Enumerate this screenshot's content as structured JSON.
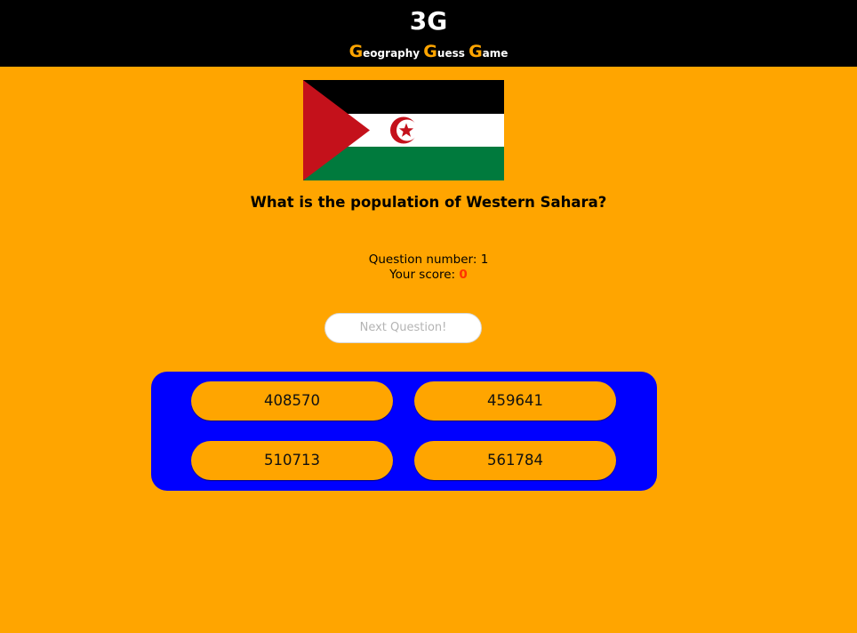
{
  "header": {
    "logo": "3G",
    "tagline": [
      {
        "cap": "G",
        "rest": "eography "
      },
      {
        "cap": "G",
        "rest": "uess "
      },
      {
        "cap": "G",
        "rest": "ame"
      }
    ]
  },
  "flag": {
    "country": "Western Sahara",
    "icon": "western-sahara-flag-icon",
    "colors": {
      "black": "#000000",
      "white": "#FFFFFF",
      "green": "#007A3D",
      "red": "#C4111B"
    }
  },
  "question": {
    "text": "What is the population of Western Sahara?"
  },
  "status": {
    "question_label": "Question number: ",
    "question_number": "1",
    "score_label": "Your score: ",
    "score_value": "0"
  },
  "next_button": {
    "label": "Next Question!"
  },
  "answers": [
    {
      "label": "408570"
    },
    {
      "label": "459641"
    },
    {
      "label": "510713"
    },
    {
      "label": "561784"
    }
  ],
  "colors": {
    "background": "#FFA500",
    "header": "#000000",
    "answers_panel": "#0000FF",
    "score": "#FF3300"
  }
}
